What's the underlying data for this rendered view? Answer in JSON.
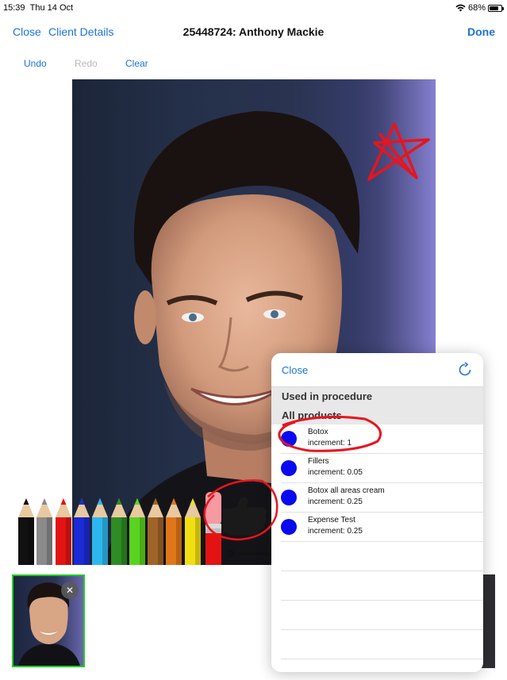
{
  "status_bar": {
    "time": "15:39",
    "date": "Thu 14 Oct",
    "battery": "68%"
  },
  "nav": {
    "close": "Close",
    "client_details": "Client Details",
    "title": "25448724: Anthony Mackie",
    "done": "Done"
  },
  "toolbar": {
    "undo": "Undo",
    "redo": "Redo",
    "clear": "Clear"
  },
  "pencil_colors": [
    "#111111",
    "#8a8a8a",
    "#e31313",
    "#1b2bd6",
    "#2eb7ee",
    "#2e8c24",
    "#59d31f",
    "#a0632a",
    "#e0761a",
    "#f2df12"
  ],
  "popover": {
    "close": "Close",
    "section_title": "Used in procedure",
    "section_subtitle": "All products",
    "items": [
      {
        "name": "Botox",
        "increment": "increment: 1"
      },
      {
        "name": "Fillers",
        "increment": "increment: 0.05"
      },
      {
        "name": "Botox all areas cream",
        "increment": "increment: 0.25"
      },
      {
        "name": "Expense Test",
        "increment": "increment: 0.25"
      }
    ],
    "dot_color": "#0a0af0"
  },
  "annotation_color": "#e8141e"
}
